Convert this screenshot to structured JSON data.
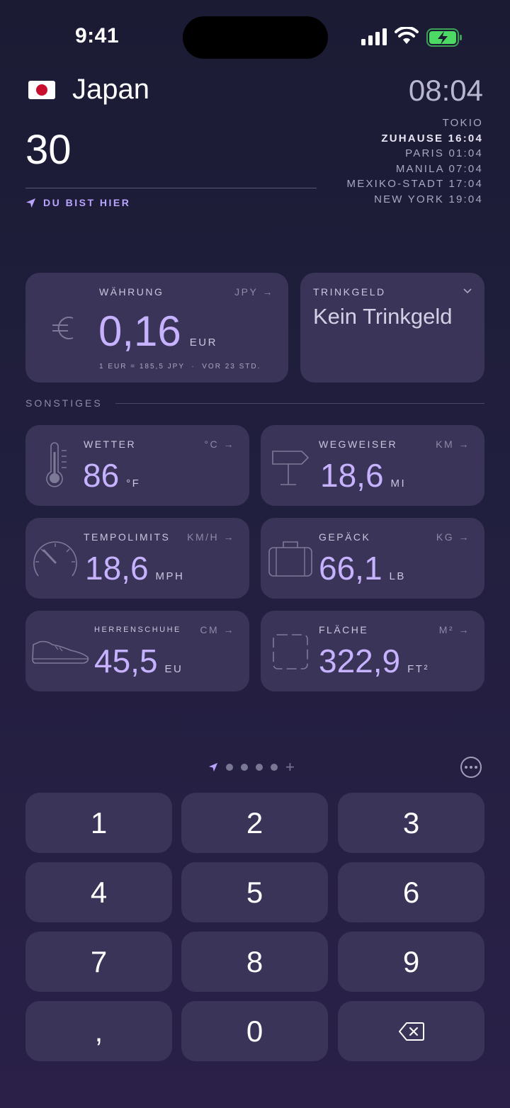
{
  "status_bar": {
    "time": "9:41"
  },
  "header": {
    "country": "Japan",
    "input_value": "30",
    "location_label": "DU BIST HIER",
    "main_clock": "08:04",
    "timezones": [
      {
        "city": "TOKIO",
        "time": ""
      },
      {
        "city": "ZUHAUSE",
        "time": "16:04"
      },
      {
        "city": "PARIS",
        "time": "01:04"
      },
      {
        "city": "MANILA",
        "time": "07:04"
      },
      {
        "city": "MEXIKO-STADT",
        "time": "17:04"
      },
      {
        "city": "NEW YORK",
        "time": "19:04"
      }
    ]
  },
  "currency": {
    "title": "WÄHRUNG",
    "unit": "JPY",
    "value": "0,16",
    "value_unit": "EUR",
    "rate_note": "1 EUR = 185,5 JPY  ·  VOR 23 STD."
  },
  "tip": {
    "title": "TRINKGELD",
    "value": "Kein Trinkgeld"
  },
  "section": {
    "label": "SONSTIGES"
  },
  "tiles": {
    "weather": {
      "title": "WETTER",
      "unit": "°C",
      "value": "86",
      "value_unit": "°F"
    },
    "signpost": {
      "title": "WEGWEISER",
      "unit": "KM",
      "value": "18,6",
      "value_unit": "MI"
    },
    "speed": {
      "title": "TEMPOLIMITS",
      "unit": "KM/H",
      "value": "18,6",
      "value_unit": "MPH"
    },
    "luggage": {
      "title": "GEPÄCK",
      "unit": "KG",
      "value": "66,1",
      "value_unit": "LB"
    },
    "shoes": {
      "title": "HERRENSCHUHE",
      "unit": "CM",
      "value": "45,5",
      "value_unit": "EU"
    },
    "area": {
      "title": "FLÄCHE",
      "unit": "M²",
      "value": "322,9",
      "value_unit": "FT²"
    }
  },
  "page_indicator": {
    "add": "+"
  },
  "keypad": {
    "k1": "1",
    "k2": "2",
    "k3": "3",
    "k4": "4",
    "k5": "5",
    "k6": "6",
    "k7": "7",
    "k8": "8",
    "k9": "9",
    "comma": ",",
    "k0": "0"
  },
  "colors": {
    "accent": "#c6b2ff",
    "card": "#3a3558",
    "background": "#1b1b34"
  }
}
